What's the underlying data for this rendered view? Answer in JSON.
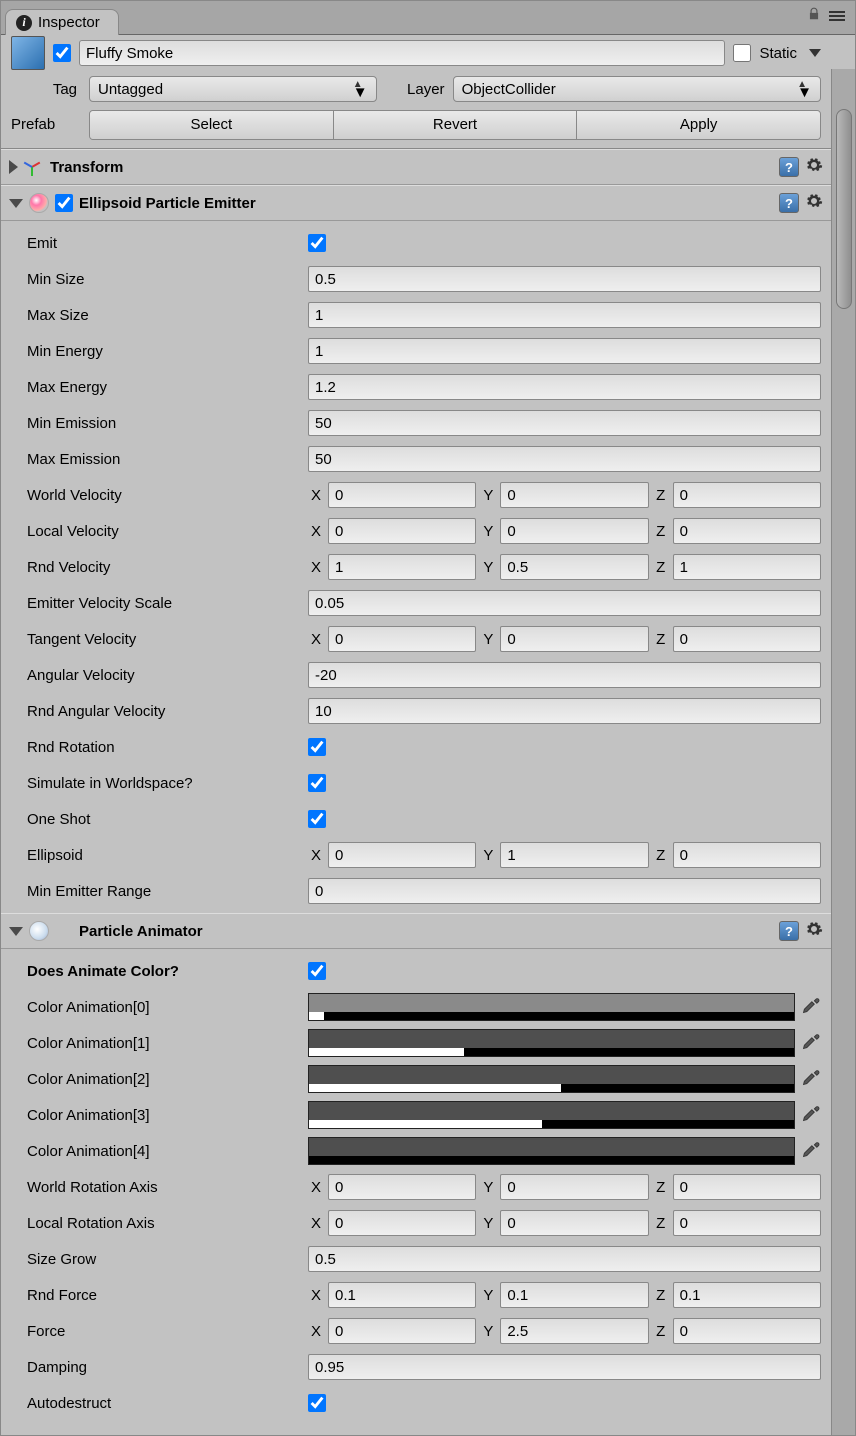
{
  "tab": {
    "title": "Inspector"
  },
  "header": {
    "name": "Fluffy Smoke",
    "active": true,
    "static_label": "Static",
    "tag_label": "Tag",
    "tag_value": "Untagged",
    "layer_label": "Layer",
    "layer_value": "ObjectCollider",
    "prefab_label": "Prefab",
    "prefab_select": "Select",
    "prefab_revert": "Revert",
    "prefab_apply": "Apply"
  },
  "transform": {
    "title": "Transform"
  },
  "emitter": {
    "title": "Ellipsoid Particle Emitter",
    "enabled": true,
    "props": {
      "emit_label": "Emit",
      "min_size_label": "Min Size",
      "min_size": "0.5",
      "max_size_label": "Max Size",
      "max_size": "1",
      "min_energy_label": "Min Energy",
      "min_energy": "1",
      "max_energy_label": "Max Energy",
      "max_energy": "1.2",
      "min_emission_label": "Min Emission",
      "min_emission": "50",
      "max_emission_label": "Max Emission",
      "max_emission": "50",
      "world_velocity_label": "World Velocity",
      "world_velocity": {
        "x": "0",
        "y": "0",
        "z": "0"
      },
      "local_velocity_label": "Local Velocity",
      "local_velocity": {
        "x": "0",
        "y": "0",
        "z": "0"
      },
      "rnd_velocity_label": "Rnd Velocity",
      "rnd_velocity": {
        "x": "1",
        "y": "0.5",
        "z": "1"
      },
      "emitter_velocity_scale_label": "Emitter Velocity Scale",
      "emitter_velocity_scale": "0.05",
      "tangent_velocity_label": "Tangent Velocity",
      "tangent_velocity": {
        "x": "0",
        "y": "0",
        "z": "0"
      },
      "angular_velocity_label": "Angular Velocity",
      "angular_velocity": "-20",
      "rnd_angular_velocity_label": "Rnd Angular Velocity",
      "rnd_angular_velocity": "10",
      "rnd_rotation_label": "Rnd Rotation",
      "sim_worldspace_label": "Simulate in Worldspace?",
      "one_shot_label": "One Shot",
      "ellipsoid_label": "Ellipsoid",
      "ellipsoid": {
        "x": "0",
        "y": "1",
        "z": "0"
      },
      "min_emitter_range_label": "Min Emitter Range",
      "min_emitter_range": "0"
    }
  },
  "animator": {
    "title": "Particle Animator",
    "props": {
      "does_animate_color_label": "Does Animate Color?",
      "color0_label": "Color Animation[0]",
      "color0": {
        "top": "#8a8a8a",
        "alpha": 3
      },
      "color1_label": "Color Animation[1]",
      "color1": {
        "top": "#4f4f4f",
        "alpha": 32
      },
      "color2_label": "Color Animation[2]",
      "color2": {
        "top": "#4f4f4f",
        "alpha": 52
      },
      "color3_label": "Color Animation[3]",
      "color3": {
        "top": "#4f4f4f",
        "alpha": 48
      },
      "color4_label": "Color Animation[4]",
      "color4": {
        "top": "#4f4f4f",
        "alpha": 0
      },
      "world_rotation_axis_label": "World Rotation Axis",
      "world_rotation_axis": {
        "x": "0",
        "y": "0",
        "z": "0"
      },
      "local_rotation_axis_label": "Local Rotation Axis",
      "local_rotation_axis": {
        "x": "0",
        "y": "0",
        "z": "0"
      },
      "size_grow_label": "Size Grow",
      "size_grow": "0.5",
      "rnd_force_label": "Rnd Force",
      "rnd_force": {
        "x": "0.1",
        "y": "0.1",
        "z": "0.1"
      },
      "force_label": "Force",
      "force": {
        "x": "0",
        "y": "2.5",
        "z": "0"
      },
      "damping_label": "Damping",
      "damping": "0.95",
      "autodestruct_label": "Autodestruct"
    }
  },
  "axis": {
    "x": "X",
    "y": "Y",
    "z": "Z"
  }
}
